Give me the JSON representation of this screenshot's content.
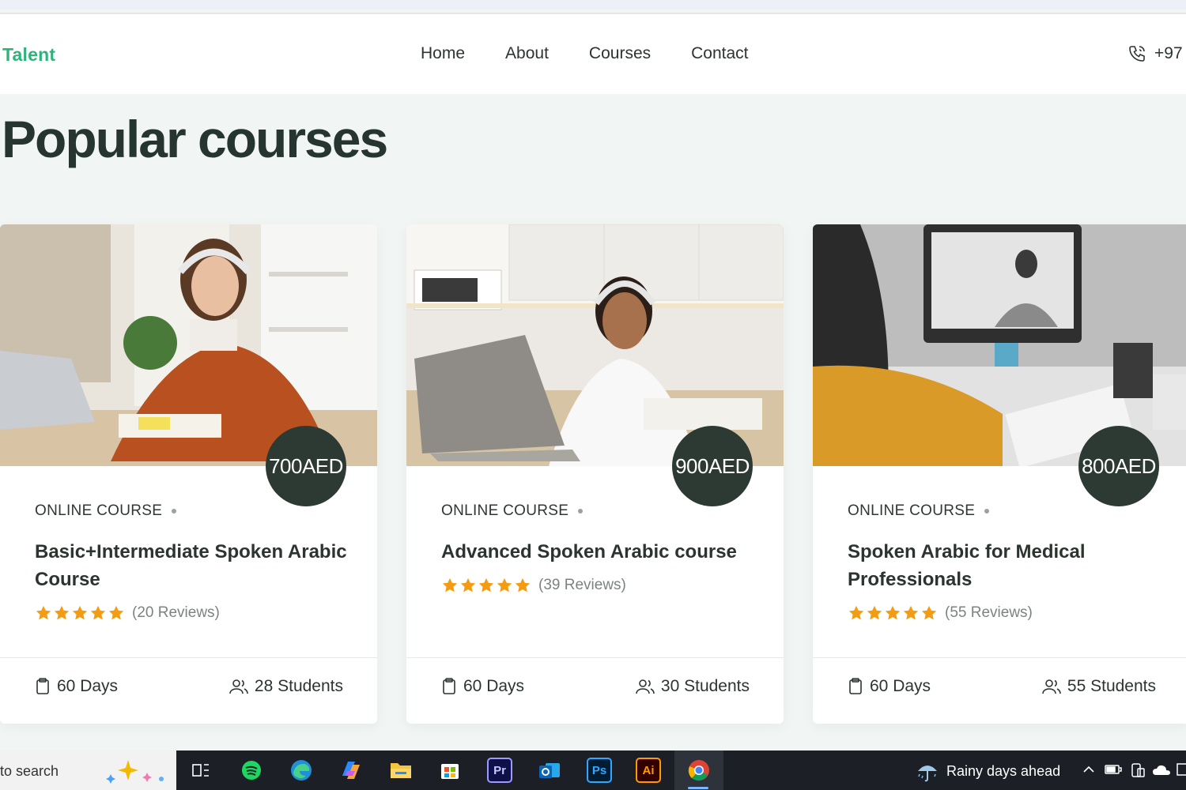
{
  "nav": {
    "brand": "Talent",
    "links": [
      "Home",
      "About",
      "Courses",
      "Contact"
    ],
    "phone": "+97"
  },
  "section": {
    "title": "Popular courses"
  },
  "courses": [
    {
      "price": "700AED",
      "category": "ONLINE COURSE",
      "title": "Basic+Intermediate Spoken Arabic Course",
      "rating": 5,
      "reviews": "(20 Reviews)",
      "duration": "60 Days",
      "students": "28 Students"
    },
    {
      "price": "900AED",
      "category": "ONLINE COURSE",
      "title": "Advanced Spoken Arabic course",
      "rating": 5,
      "reviews": "(39 Reviews)",
      "duration": "60 Days",
      "students": "30 Students"
    },
    {
      "price": "800AED",
      "category": "ONLINE COURSE",
      "title": "Spoken Arabic for Medical Professionals",
      "rating": 5,
      "reviews": "(55 Reviews)",
      "duration": "60 Days",
      "students": "55 Students"
    }
  ],
  "colors": {
    "brand": "#2fb37a",
    "dark": "#2c3a33",
    "star": "#f39c12",
    "background": "#f1f6f5"
  },
  "taskbar": {
    "search_text": "to search",
    "weather_text": "Rainy days ahead",
    "apps": [
      "task-view-icon",
      "spotify-icon",
      "edge-icon",
      "copilot-icon",
      "file-explorer-icon",
      "store-icon",
      "premiere-icon",
      "outlook-icon",
      "photoshop-icon",
      "illustrator-icon",
      "chrome-icon"
    ],
    "premiere_label": "Pr",
    "photoshop_label": "Ps",
    "illustrator_label": "Ai"
  }
}
